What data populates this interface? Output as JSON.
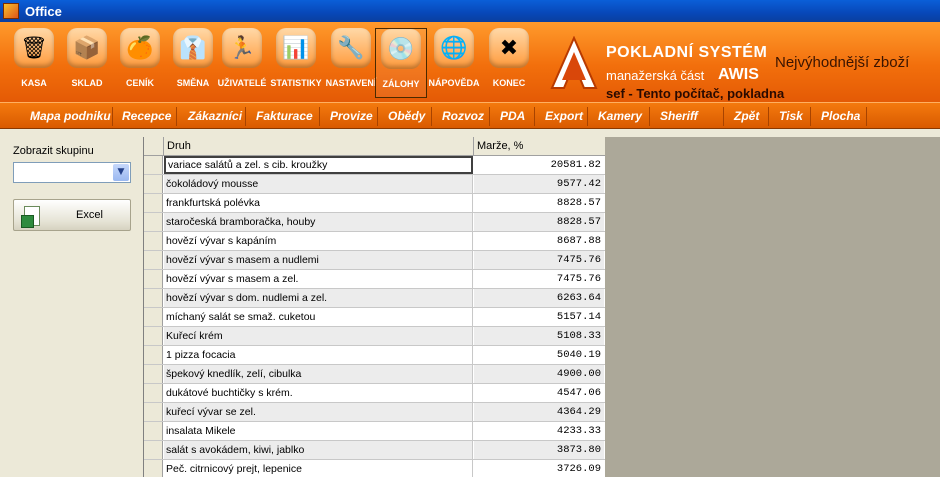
{
  "window": {
    "title": "Office"
  },
  "toolbar": {
    "buttons": [
      {
        "label": "KASA",
        "icon": "cash-register-icon"
      },
      {
        "label": "SKLAD",
        "icon": "warehouse-boxes-icon"
      },
      {
        "label": "CENÍK",
        "icon": "price-list-icon"
      },
      {
        "label": "SMĚNA",
        "icon": "shift-tie-icon"
      },
      {
        "label": "UŽIVATELÉ",
        "icon": "users-icon"
      },
      {
        "label": "STATISTIKY",
        "icon": "statistics-chart-icon"
      },
      {
        "label": "NASTAVENÍ",
        "icon": "settings-tools-icon"
      },
      {
        "label": "ZÁLOHY",
        "icon": "backup-disc-icon"
      },
      {
        "label": "NÁPOVĚDA",
        "icon": "help-globe-icon"
      },
      {
        "label": "KONEC",
        "icon": "exit-icon"
      }
    ],
    "active_index": 7
  },
  "brand": {
    "title": "POKLADNÍ SYSTÉM",
    "subtitle": "manažerská část",
    "name": "AWIS",
    "user": "sef  -  Tento počítač, pokladna",
    "tagline": "Nejvýhodnější zboží"
  },
  "menu": {
    "items": [
      "Mapa podniku",
      "Recepce",
      "Zákazníci",
      "Fakturace",
      "Provize",
      "Obědy",
      "Rozvoz",
      "PDA",
      "Export",
      "Kamery",
      "Sheriff",
      "Zpět",
      "Tisk",
      "Plocha"
    ]
  },
  "left_panel": {
    "group_label": "Zobrazit skupinu",
    "group_value": "",
    "excel_label": "Excel"
  },
  "grid": {
    "columns": [
      "Druh",
      "Marže, %"
    ],
    "rows": [
      {
        "name": "variace salátů a zel. s cib. kroužky",
        "value": "20581.82"
      },
      {
        "name": "čokoládový mousse",
        "value": "9577.42"
      },
      {
        "name": "frankfurtská polévka",
        "value": "8828.57"
      },
      {
        "name": "staročeská bramboračka, houby",
        "value": "8828.57"
      },
      {
        "name": "hovězí vývar s kapáním",
        "value": "8687.88"
      },
      {
        "name": "hovězí vývar s masem a nudlemi",
        "value": "7475.76"
      },
      {
        "name": "hovězí vývar s masem a zel.",
        "value": "7475.76"
      },
      {
        "name": "hovězí vývar s dom. nudlemi a zel.",
        "value": "6263.64"
      },
      {
        "name": "míchaný salát se smaž. cuketou",
        "value": "5157.14"
      },
      {
        "name": "Kuřecí krém",
        "value": "5108.33"
      },
      {
        "name": "1 pizza focacia",
        "value": "5040.19"
      },
      {
        "name": "špekový knedlík, zelí, cibulka",
        "value": "4900.00"
      },
      {
        "name": "dukátové buchtičky s krém.",
        "value": "4547.06"
      },
      {
        "name": "kuřecí vývar se zel.",
        "value": "4364.29"
      },
      {
        "name": "insalata Mikele",
        "value": "4233.33"
      },
      {
        "name": "salát s avokádem, kiwi, jablko",
        "value": "3873.80"
      },
      {
        "name": "Peč. citrnicový prejt, lepenice",
        "value": "3726.09"
      }
    ]
  }
}
